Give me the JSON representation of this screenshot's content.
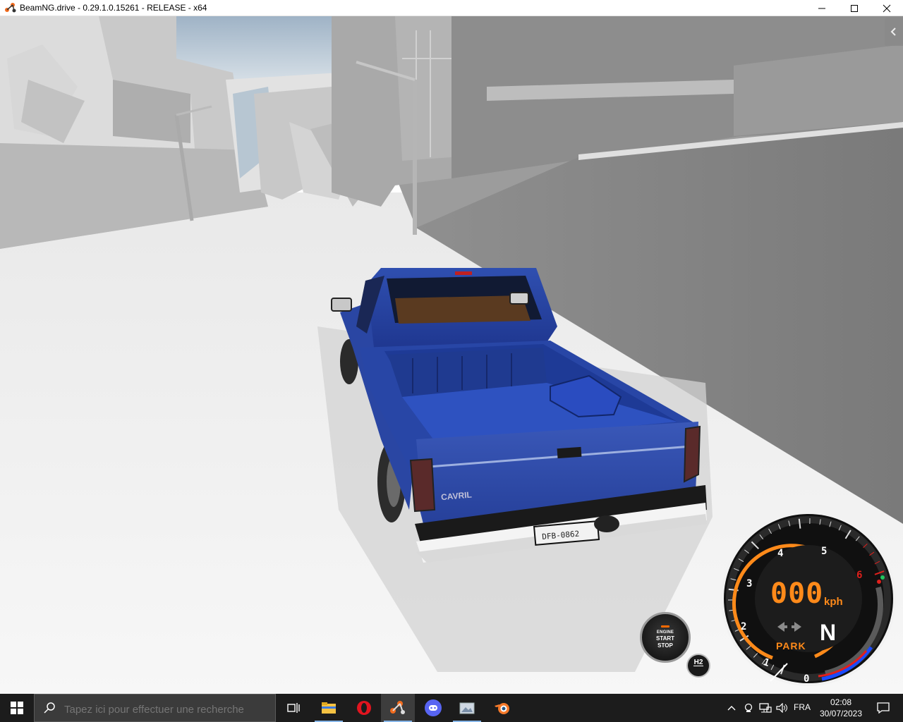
{
  "window": {
    "title": "BeamNG.drive - 0.29.1.0.15261 - RELEASE - x64"
  },
  "hud": {
    "engine_button": {
      "line1": "ENGINE",
      "line2": "START",
      "line3": "STOP"
    },
    "badge": "H2",
    "gauge": {
      "speed": "000",
      "unit": "kph",
      "gear": "N",
      "status": "PARK",
      "rpm_labels": [
        "0",
        "1",
        "2",
        "3",
        "4",
        "5",
        "6"
      ],
      "redline_label": "6"
    },
    "license_plate": "DFB-0862",
    "colors": {
      "accent": "#ff8a1a",
      "redline": "#e0201c",
      "truck_blue": "#2b4aa8"
    }
  },
  "taskbar": {
    "search_placeholder": "Tapez ici pour effectuer une recherche",
    "apps": [
      "task-view-icon",
      "file-explorer-icon",
      "opera-icon",
      "beamng-icon",
      "discord-icon",
      "photos-icon",
      "blender-icon"
    ],
    "language": "FRA",
    "time": "02:08",
    "date": "30/07/2023"
  }
}
